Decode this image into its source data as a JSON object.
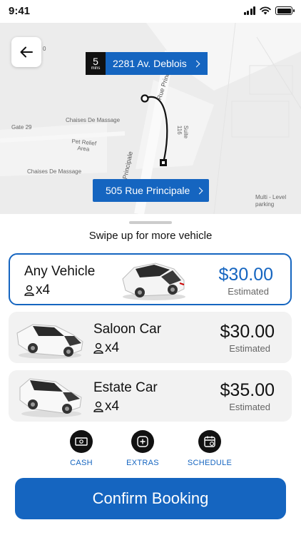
{
  "status_bar": {
    "time": "9:41"
  },
  "map": {
    "eta": {
      "value": "5",
      "unit": "mins"
    },
    "pickup_address": "2281 Av. Deblois",
    "dropoff_address": "505 Rue Principale",
    "labels": {
      "gate": "Gate 29",
      "massage_1": "Chaises De Massage",
      "massage_2": "Chaises De Massage",
      "pet_relief": "Pet Relief\nArea",
      "suite": "Suite\n116",
      "street_1": "Rue Principale",
      "street_2": "Principale",
      "parking": "Multi - Level\nparking",
      "zero": "0"
    }
  },
  "sheet": {
    "swipe_hint": "Swipe up for more vehicle",
    "vehicles": [
      {
        "name": "Any Vehicle",
        "passengers": "x4",
        "price": "$30.00",
        "price_note": "Estimated"
      },
      {
        "name": "Saloon Car",
        "passengers": "x4",
        "price": "$30.00",
        "price_note": "Estimated"
      },
      {
        "name": "Estate Car",
        "passengers": "x4",
        "price": "$35.00",
        "price_note": "Estimated"
      }
    ],
    "options": [
      {
        "label": "CASH",
        "icon": "cash-icon"
      },
      {
        "label": "EXTRAS",
        "icon": "plus-icon"
      },
      {
        "label": "SCHEDULE",
        "icon": "calendar-icon"
      }
    ],
    "confirm_label": "Confirm Booking"
  },
  "colors": {
    "accent": "#1565c0",
    "map_bg": "#ededed",
    "dark": "#111111"
  }
}
